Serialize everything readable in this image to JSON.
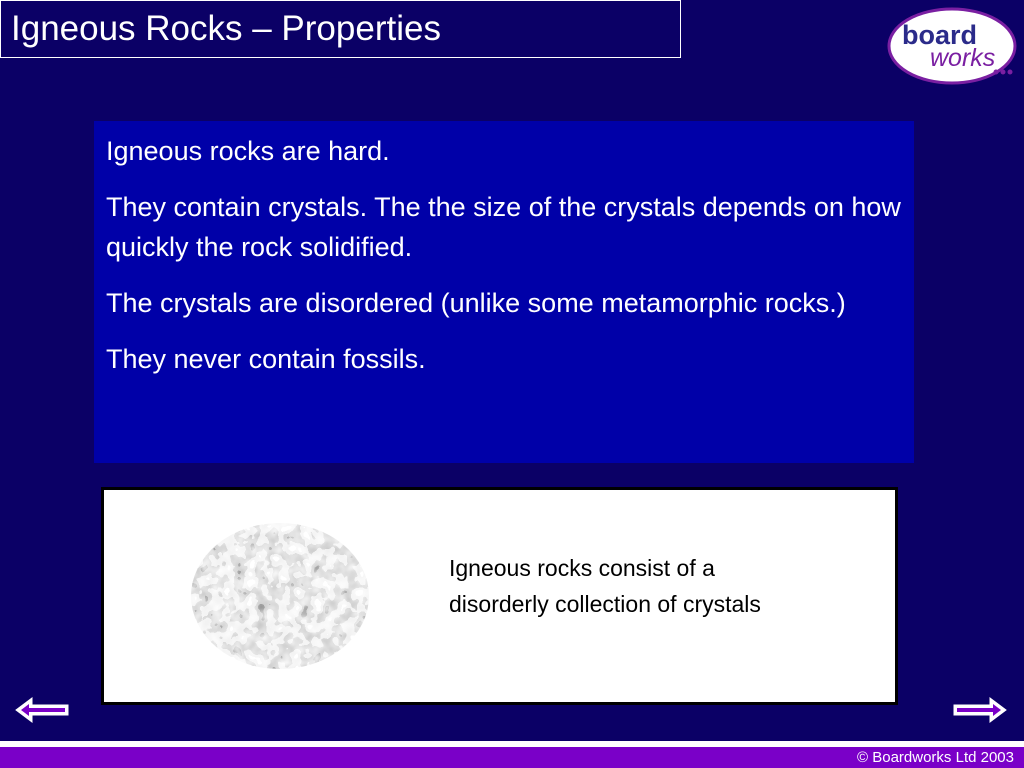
{
  "slide": {
    "title": "Igneous Rocks – Properties"
  },
  "logo": {
    "icon": "boardworks-logo",
    "line1": "board",
    "line2": "works"
  },
  "text_panel": {
    "paragraphs": [
      "Igneous rocks are hard.",
      "They contain crystals.  The the size of the crystals depends on how quickly the rock solidified.",
      "The crystals are disordered (unlike some metamorphic rocks.)",
      "They never contain fossils."
    ]
  },
  "image_panel": {
    "image_icon": "igneous-rock-crystals-image",
    "caption_line1": "Igneous rocks consist of a",
    "caption_line2": "disorderly collection of crystals"
  },
  "navigation": {
    "back_icon": "left-arrow-icon",
    "forward_icon": "right-arrow-icon"
  },
  "footer": {
    "copyright": "© Boardworks Ltd 2003"
  },
  "colors": {
    "background": "#0b0066",
    "panel": "#0000a8",
    "footer": "#7a00c8",
    "logo_purple": "#6a1b9a",
    "logo_blue": "#2b2b8a"
  }
}
